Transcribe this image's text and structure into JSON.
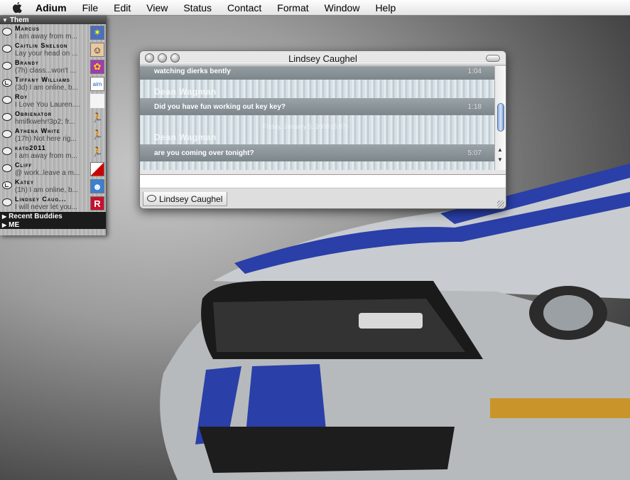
{
  "menubar": {
    "app_name": "Adium",
    "items": [
      "File",
      "Edit",
      "View",
      "Status",
      "Contact",
      "Format",
      "Window",
      "Help"
    ]
  },
  "buddy_list": {
    "group_them": "Them",
    "group_recent": "Recent Buddies",
    "group_me": "ME",
    "buddies": [
      {
        "name": "Marcus",
        "status": "I am away from m..."
      },
      {
        "name": "Caitlin Snelson",
        "status": "Lay your head on ..."
      },
      {
        "name": "Brandy",
        "status": "(7h) class...won't ..."
      },
      {
        "name": "Tiffany Williams",
        "status": "(3d) I am online, b..."
      },
      {
        "name": "Roy",
        "status": "I Love You Lauren...."
      },
      {
        "name": "Obrienator",
        "status": "hmifkwehr!3p2; fr..."
      },
      {
        "name": "Athena White",
        "status": "(17h) Not here rig..."
      },
      {
        "name": "katd2011",
        "status": "I am away from m..."
      },
      {
        "name": "Cliff",
        "status": "@ work..leave a m..."
      },
      {
        "name": "Katey",
        "status": "(1h) I am online, b..."
      },
      {
        "name": "Lindsey Caug...",
        "status": "I will never let you..."
      }
    ]
  },
  "chat_window": {
    "title": "Lindsey Caughel",
    "messages": [
      {
        "text": "watching dierks bently",
        "time": "1:04"
      },
      {
        "text": "Did you have fun working out key key?",
        "time": "1:18"
      },
      {
        "text": "are you coming over tonight?",
        "time": "5:07"
      }
    ],
    "ghost_sender": "Dean Wagman",
    "ghost_date": "Friday, January 5, 2008 (5:07)",
    "tab_label": "Lindsey Caughel"
  }
}
